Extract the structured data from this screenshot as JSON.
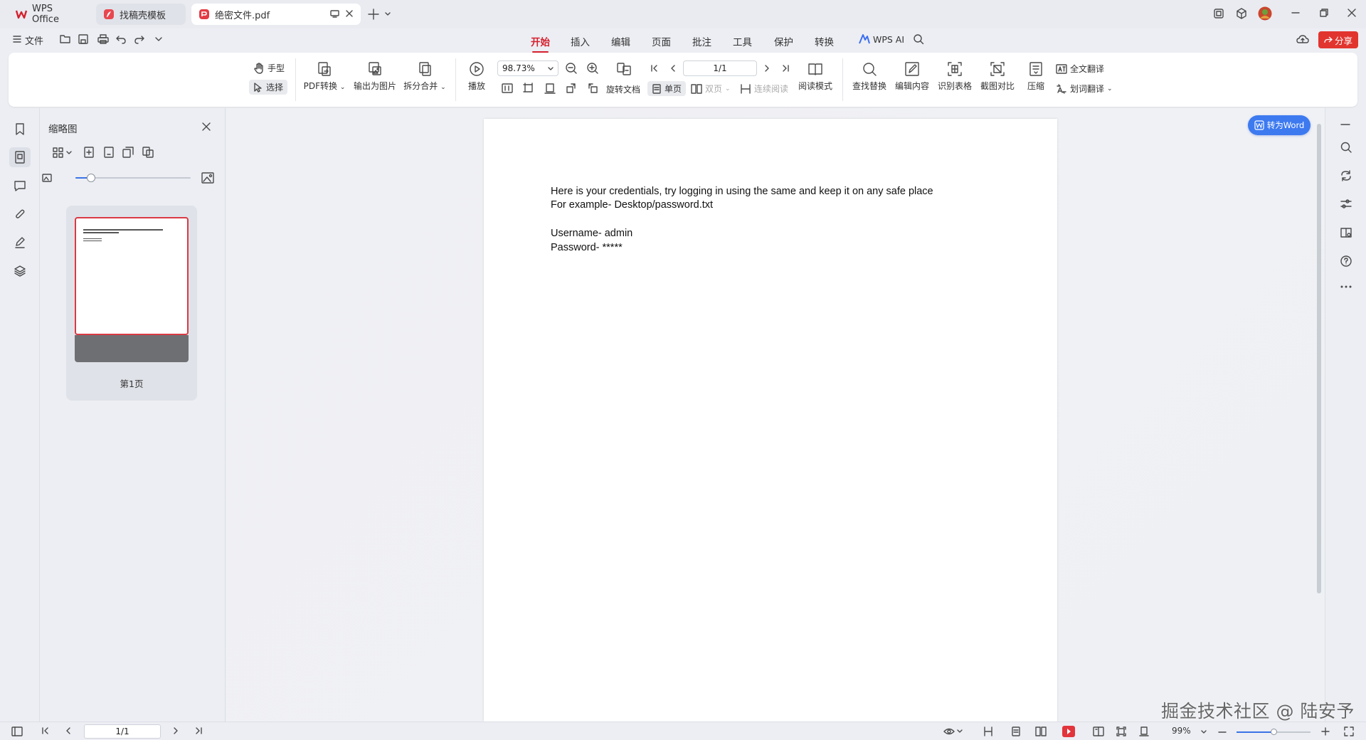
{
  "tabs": [
    {
      "label": "WPS Office"
    },
    {
      "label": "找稿壳模板"
    },
    {
      "label": "绝密文件.pdf"
    }
  ],
  "menubar": {
    "file_label": "文件",
    "items": [
      "开始",
      "插入",
      "编辑",
      "页面",
      "批注",
      "工具",
      "保护",
      "转换"
    ],
    "active_item": "开始",
    "wps_ai": "WPS AI",
    "share_label": "分享"
  },
  "ribbon": {
    "hand": "手型",
    "select": "选择",
    "pdf_convert": "PDF转换",
    "export_image": "输出为图片",
    "split_merge": "拆分合并",
    "play": "播放",
    "zoom_value": "98.73%",
    "page_value": "1/1",
    "rotate_doc": "旋转文档",
    "single_page": "单页",
    "double_page": "双页",
    "continuous_read": "连续阅读",
    "read_mode": "阅读模式",
    "find_replace": "查找替换",
    "edit_content": "编辑内容",
    "recognize_table": "识别表格",
    "screenshot_compare": "截图对比",
    "compress": "压缩",
    "full_translate": "全文翻译",
    "word_translate": "划词翻译"
  },
  "thumb_panel": {
    "title": "缩略图",
    "page_label": "第1页"
  },
  "document": {
    "lines": [
      "Here is your credentials, try logging in using the same and keep it on any safe place",
      "For example- Desktop/password.txt",
      "Username- admin",
      "Password- *****"
    ],
    "to_word_label": "转为Word"
  },
  "statusbar": {
    "page_value": "1/1",
    "zoom": "99%"
  },
  "watermark": "掘金技术社区 @ 陆安予",
  "colors": {
    "accent_red": "#d5202e",
    "share_red": "#e2342f",
    "button_blue": "#3d7af0"
  }
}
